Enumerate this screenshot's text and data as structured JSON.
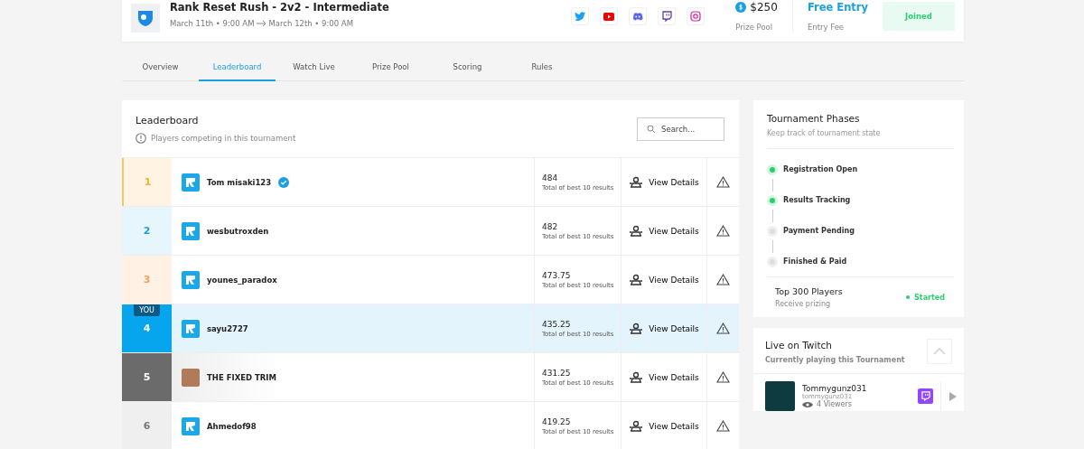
{
  "header": {
    "title": "Rank Reset Rush - 2v2 - Intermediate",
    "date_start": "March 11th • 9:00 AM",
    "date_end": "March 12th • 9:00 AM",
    "socials": [
      {
        "kind": "twitter"
      },
      {
        "kind": "youtube"
      },
      {
        "kind": "discord"
      },
      {
        "kind": "twitch"
      },
      {
        "kind": "instagram"
      }
    ],
    "prize": "$250",
    "prize_label": "Prize Pool",
    "fee": "Free Entry",
    "fee_label": "Entry Fee",
    "status": "Joined"
  },
  "tabs": [
    {
      "label": "Overview",
      "selected": false
    },
    {
      "label": "Leaderboard",
      "selected": true
    },
    {
      "label": "Watch Live",
      "selected": false
    },
    {
      "label": "Prize Pool",
      "selected": false
    },
    {
      "label": "Scoring",
      "selected": false
    },
    {
      "label": "Rules",
      "selected": false
    }
  ],
  "leaderboard": {
    "title": "Leaderboard",
    "subtitle": "Players competing in this tournament",
    "search": {
      "placeholder": "Search..."
    },
    "rows": [
      {
        "rank": "1",
        "kind": "first",
        "name": "Tom misaki123",
        "verified": true,
        "avatar": {
          "kind": "logo"
        },
        "score": "484",
        "score_note": "Total of best 10 results",
        "action": "View Details"
      },
      {
        "rank": "2",
        "kind": "second",
        "name": "wesbutroxden",
        "verified": false,
        "avatar": {
          "kind": "logo"
        },
        "score": "482",
        "score_note": "Total of best 10 results",
        "action": "View Details"
      },
      {
        "rank": "3",
        "kind": "third",
        "name": "younes_paradox",
        "verified": false,
        "avatar": {
          "kind": "logo"
        },
        "score": "473.75",
        "score_note": "Total of best 10 results",
        "action": "View Details"
      },
      {
        "rank": "4",
        "kind": "self",
        "badge": "YOU",
        "name": "sayu2727",
        "verified": false,
        "avatar": {
          "kind": "logo"
        },
        "score": "435.25",
        "score_note": "Total of best 10 results",
        "action": "View Details"
      },
      {
        "rank": "5",
        "kind": "featured",
        "name": "THE FIXED TRIM",
        "verified": false,
        "avatar": {
          "kind": "photo"
        },
        "score": "431.25",
        "score_note": "Total of best 10 results",
        "action": "View Details"
      },
      {
        "rank": "6",
        "kind": "normal",
        "name": "Ahmedof98",
        "verified": false,
        "avatar": {
          "kind": "logo"
        },
        "score": "419.25",
        "score_note": "Total of best 10 results",
        "action": "View Details"
      }
    ]
  },
  "phases": {
    "title": "Tournament Phases",
    "subtitle": "Keep track of tournament state",
    "items": [
      {
        "label": "Registration Open",
        "done": true
      },
      {
        "label": "Results Tracking",
        "done": true
      },
      {
        "label": "Payment Pending",
        "done": false
      },
      {
        "label": "Finished & Paid",
        "done": false
      }
    ],
    "prize_title": "Top 300 Players",
    "prize_sub": "Receive prizing",
    "prize_status": "Started"
  },
  "twitch": {
    "title": "Live on Twitch",
    "subtitle": "Currently playing this Tournament",
    "streams": [
      {
        "name": "Tommygunz031",
        "handle": "tommygunz031",
        "viewers": "4 Viewers"
      }
    ]
  }
}
